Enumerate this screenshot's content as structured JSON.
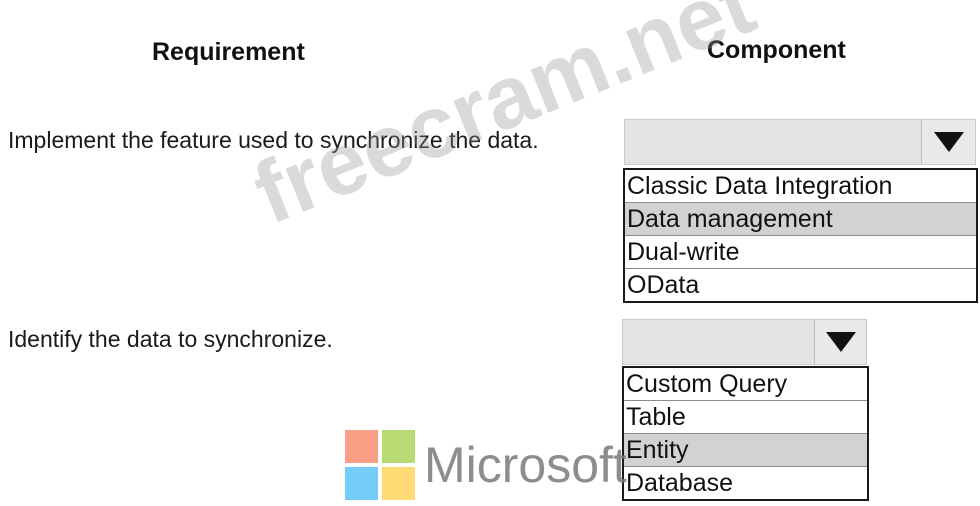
{
  "headers": {
    "requirement": "Requirement",
    "component": "Component"
  },
  "rows": [
    {
      "requirement": "Implement the feature used to synchronize the data.",
      "selected_value": "",
      "options": [
        "Classic Data Integration",
        "Data management",
        "Dual-write",
        "OData"
      ],
      "highlighted_option": "Data management"
    },
    {
      "requirement": "Identify the data to synchronize.",
      "selected_value": "",
      "options": [
        "Custom Query",
        "Table",
        "Entity",
        "Database"
      ],
      "highlighted_option": "Entity"
    }
  ],
  "watermark": "freecram.net",
  "logo": {
    "text": "Microsoft",
    "colors": [
      "#f25022",
      "#7fba00",
      "#00a4ef",
      "#ffb900"
    ]
  },
  "icons": {
    "dropdown_arrow": "triangle-down-icon"
  }
}
